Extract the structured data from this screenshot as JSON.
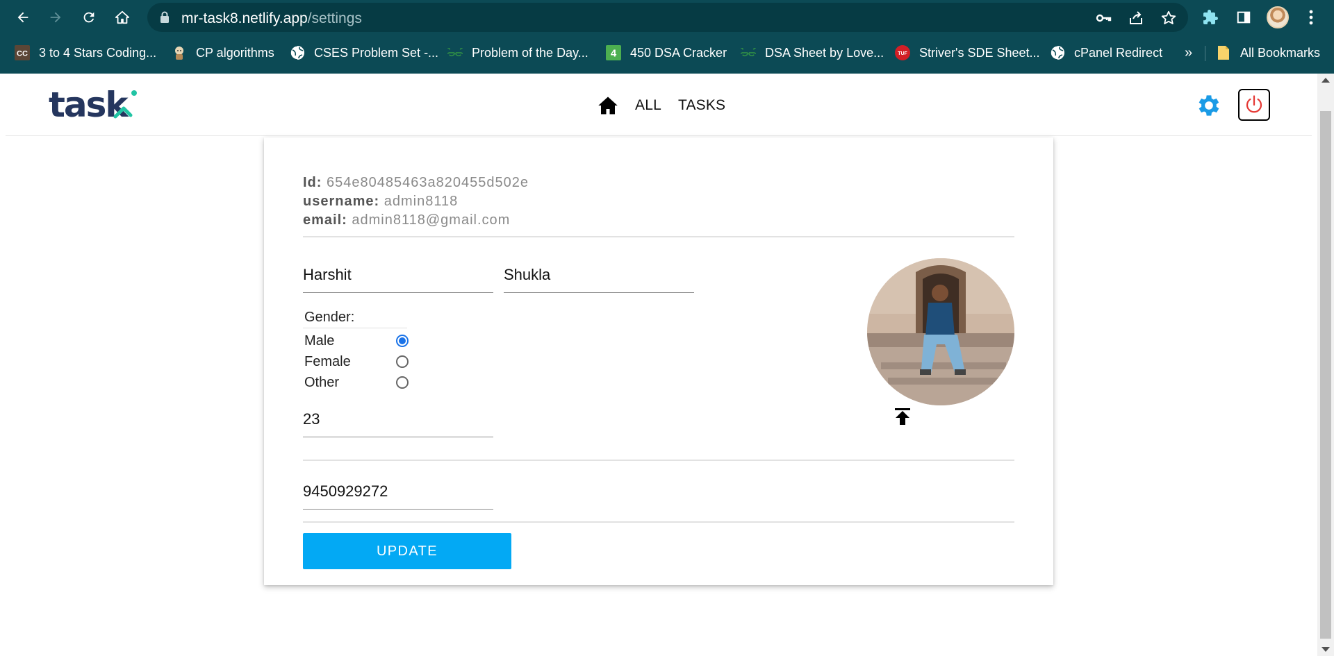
{
  "browser": {
    "url_host": "mr-task8.netlify.app",
    "url_path": "/settings",
    "bookmarks": [
      {
        "label": "3 to 4 Stars Coding...",
        "icon": "cc-logo-icon"
      },
      {
        "label": "CP algorithms",
        "icon": "cp-algorithms-icon"
      },
      {
        "label": "CSES Problem Set -...",
        "icon": "globe-icon"
      },
      {
        "label": "Problem of the Day...",
        "icon": "gfg-icon"
      },
      {
        "label": "450 DSA Cracker",
        "icon": "four-badge-icon"
      },
      {
        "label": "DSA Sheet by Love...",
        "icon": "gfg-icon"
      },
      {
        "label": "Striver's SDE Sheet...",
        "icon": "tuf-icon"
      },
      {
        "label": "cPanel Redirect",
        "icon": "globe-icon"
      }
    ],
    "overflow": "»",
    "all_bookmarks": "All Bookmarks"
  },
  "app": {
    "logo_text": "task",
    "nav": {
      "all": "ALL",
      "tasks": "TASKS"
    },
    "accent": "#03a9f4",
    "power_color": "#e53935"
  },
  "profile": {
    "id_label": "Id:",
    "id": "654e80485463a820455d502e",
    "username_label": "username:",
    "username": "admin8118",
    "email_label": "email:",
    "email": "admin8118@gmail.com",
    "first_name": "Harshit",
    "last_name": "Shukla",
    "gender_label": "Gender:",
    "gender_options": [
      "Male",
      "Female",
      "Other"
    ],
    "gender_selected": "Male",
    "age": "23",
    "phone": "9450929272",
    "update_label": "UPDATE"
  }
}
